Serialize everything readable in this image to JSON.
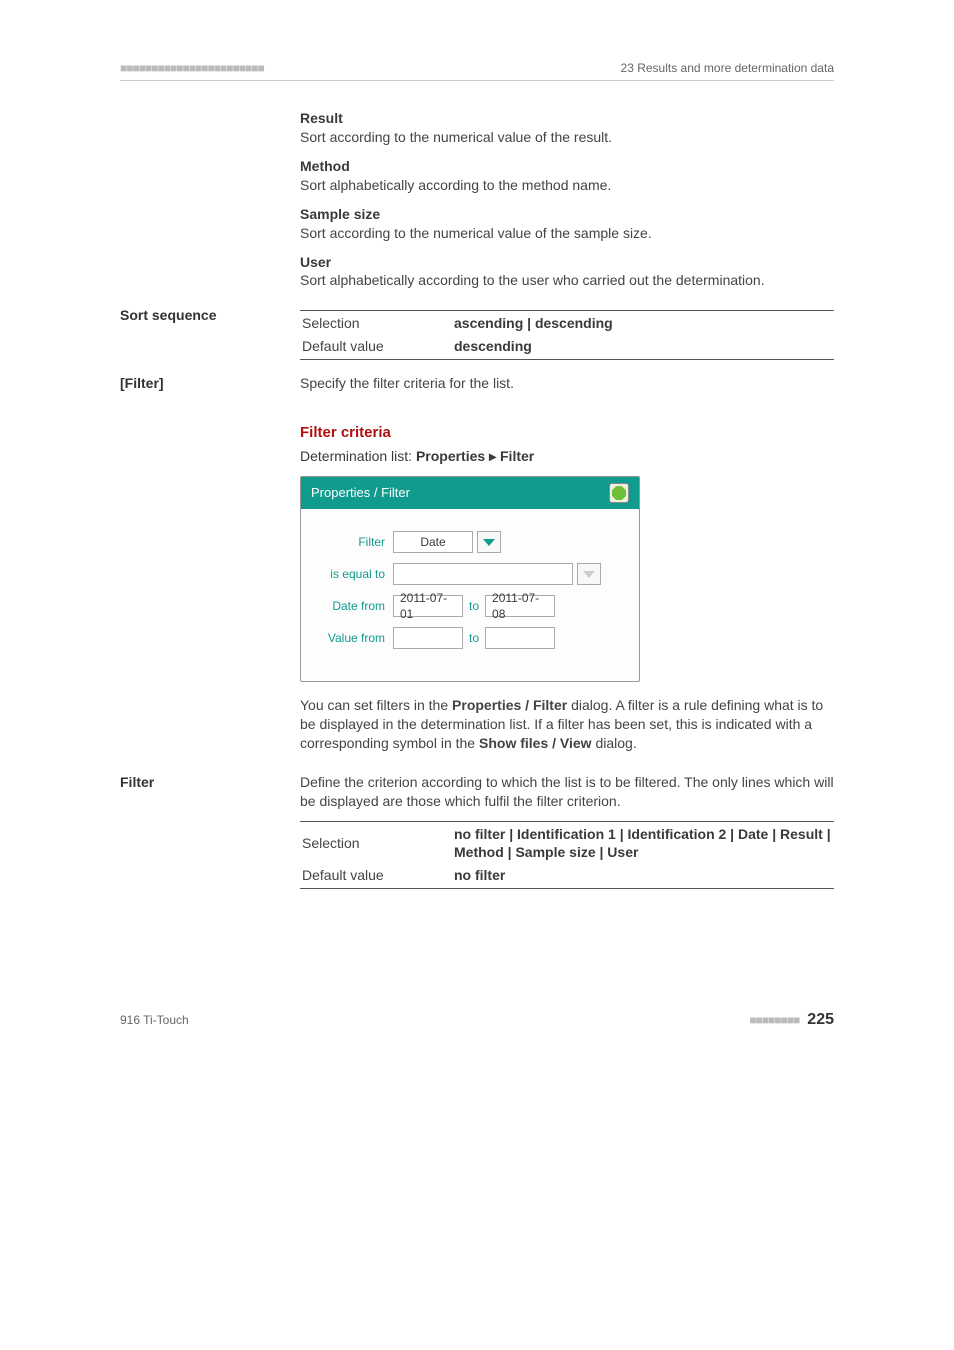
{
  "header": {
    "left_decor": "■■■■■■■■■■■■■■■■■■■■■■■",
    "right_text": "23 Results and more determination data"
  },
  "sort_defs": {
    "result": {
      "term": "Result",
      "desc": "Sort according to the numerical value of the result."
    },
    "method": {
      "term": "Method",
      "desc": "Sort alphabetically according to the method name."
    },
    "sample": {
      "term": "Sample size",
      "desc": "Sort according to the numerical value of the sample size."
    },
    "user": {
      "term": "User",
      "desc": "Sort alphabetically according to the user who carried out the determination."
    }
  },
  "sort_sequence": {
    "heading": "Sort sequence",
    "selection_label": "Selection",
    "selection_value": "ascending | descending",
    "default_label": "Default value",
    "default_value": "descending"
  },
  "filter_section": {
    "heading": "[Filter]",
    "intro": "Specify the filter criteria for the list."
  },
  "filter_criteria": {
    "heading": "Filter criteria",
    "breadcrumb_prefix": "Determination list: ",
    "breadcrumb_b1": "Properties",
    "breadcrumb_sep": " ▸ ",
    "breadcrumb_b2": "Filter"
  },
  "dialog": {
    "title": "Properties / Filter",
    "rows": {
      "filter_label": "Filter",
      "filter_value": "Date",
      "equal_label": "is equal to",
      "equal_value": "",
      "date_label": "Date from",
      "date_from": "2011-07-01",
      "to": "to",
      "date_to": "2011-07-08",
      "value_label": "Value from",
      "value_from": "",
      "value_to": ""
    }
  },
  "filter_desc": {
    "p1a": "You can set filters in the ",
    "p1b": "Properties / Filter",
    "p1c": " dialog. A filter is a rule defining what is to be displayed in the determination list. If a filter has been set, this is indicated with a corresponding symbol in the ",
    "p1d": "Show files / View",
    "p1e": " dialog."
  },
  "filter_param": {
    "heading": "Filter",
    "intro": "Define the criterion according to which the list is to be filtered. The only lines which will be displayed are those which fulfil the filter criterion.",
    "selection_label": "Selection",
    "selection_value": "no filter | Identification 1 | Identification 2 | Date | Result | Method | Sample size | User",
    "default_label": "Default value",
    "default_value": "no filter"
  },
  "footer": {
    "left": "916 Ti-Touch",
    "squares": "■■■■■■■■",
    "page": "225"
  }
}
